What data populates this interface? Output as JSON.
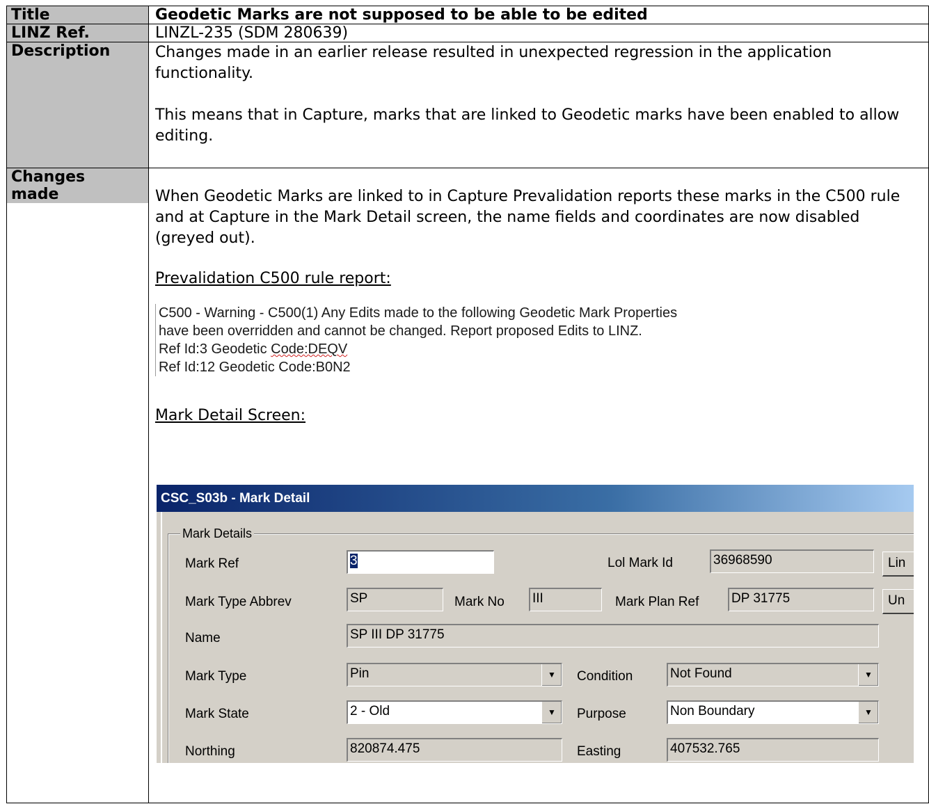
{
  "rows": {
    "title": {
      "label": "Title",
      "value": "Geodetic Marks are not supposed to be able to be edited"
    },
    "ref": {
      "label": "LINZ Ref.",
      "value": "LINZL-235 (SDM 280639)"
    },
    "description": {
      "label": "Description",
      "p1": "Changes made in an earlier release resulted in unexpected regression in the application functionality.",
      "p2": "This means that in Capture, marks that are linked to Geodetic marks have been enabled to allow editing."
    },
    "changes": {
      "label_line1": "Changes",
      "label_line2": "made",
      "p1": "When Geodetic Marks are linked to in Capture Prevalidation reports these marks in the C500 rule and at Capture in the Mark Detail screen, the name fields and coordinates are now disabled (greyed out).",
      "report_heading": "Prevalidation C500 rule report:",
      "report_lines": {
        "l1": "C500 - Warning - C500(1) Any Edits made to the following Geodetic Mark Properties",
        "l2": "have been overridden and cannot be changed. Report proposed Edits to LINZ.",
        "l3a": "Ref Id:3 Geodetic ",
        "l3b": "Code:DEQV",
        "l4": "Ref Id:12 Geodetic Code:B0N2"
      },
      "screen_heading": "Mark Detail Screen:"
    }
  },
  "dialog": {
    "title": "CSC_S03b - Mark Detail",
    "group_label": "Mark Details",
    "mark_ref_label": "Mark Ref",
    "mark_ref_value": "3",
    "lol_mark_id_label": "Lol Mark Id",
    "lol_mark_id_value": "36968590",
    "btn_link": "Lin",
    "btn_unlink": "Un",
    "mark_type_abbrev_label": "Mark Type Abbrev",
    "mark_type_abbrev_value": "SP",
    "mark_no_label": "Mark No",
    "mark_no_value": "III",
    "mark_plan_ref_label": "Mark Plan Ref",
    "mark_plan_ref_value": "DP 31775",
    "name_label": "Name",
    "name_value": "SP III DP 31775",
    "mark_type_label": "Mark Type",
    "mark_type_value": "Pin",
    "condition_label": "Condition",
    "condition_value": "Not Found",
    "mark_state_label": "Mark State",
    "mark_state_value": "2 - Old",
    "purpose_label": "Purpose",
    "purpose_value": "Non Boundary",
    "northing_label": "Northing",
    "northing_value": "820874.475",
    "easting_label": "Easting",
    "easting_value": "407532.765",
    "dropdown_icon": "chevron-down-icon"
  }
}
